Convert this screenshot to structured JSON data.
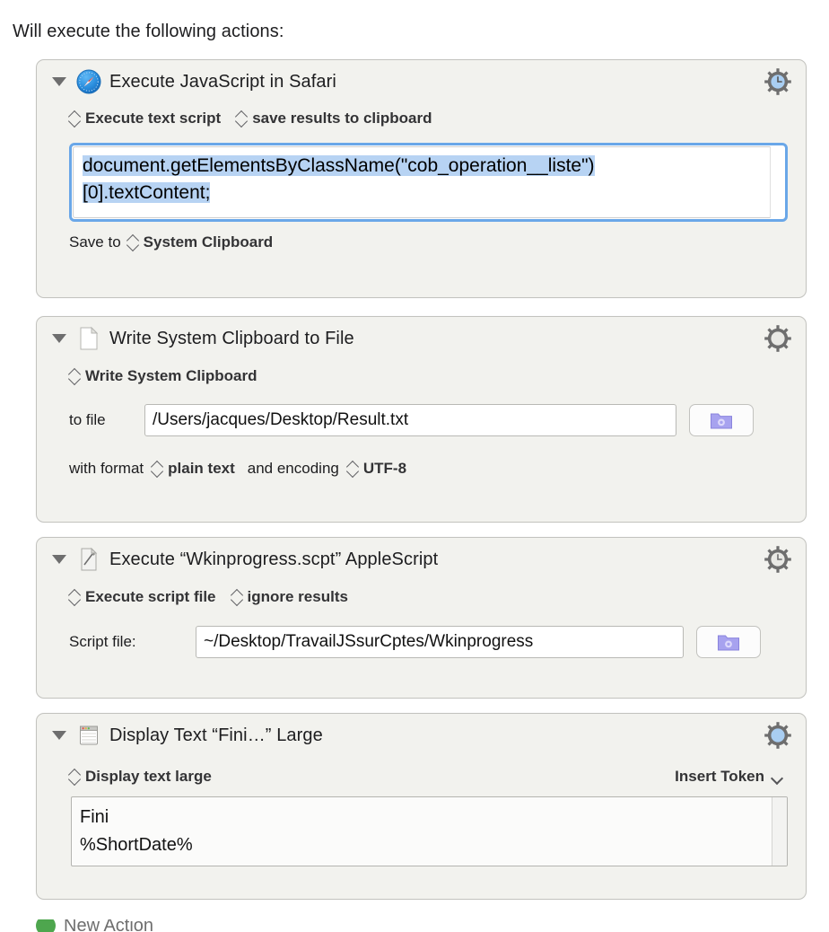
{
  "header": {
    "prompt": "Will execute the following actions:"
  },
  "actions": [
    {
      "icon": "safari-icon",
      "title": "Execute JavaScript in Safari",
      "gear": "gear-clock-blue-icon",
      "popup_mode": "Execute text script",
      "popup_results": "save results to clipboard",
      "script_selected_line1": "document.getElementsByClassName(\"cob_operation__liste\")",
      "script_selected_line2": "[0].textContent;",
      "save_to_label": "Save to",
      "save_to_value": "System Clipboard"
    },
    {
      "icon": "document-icon",
      "title": "Write System Clipboard to File",
      "gear": "gear-gray-icon",
      "popup_source": "Write System Clipboard",
      "to_file_label": "to file",
      "to_file_value": "/Users/jacques/Desktop/Result.txt",
      "folder_button": "folder-gear-icon",
      "format_label": "with format",
      "format_value": "plain text",
      "encoding_label": "and encoding",
      "encoding_value": "UTF-8"
    },
    {
      "icon": "applescript-icon",
      "title": "Execute “Wkinprogress.scpt” AppleScript",
      "gear": "gear-clock-gray-icon",
      "popup_mode": "Execute script file",
      "popup_results": "ignore results",
      "script_file_label": "Script file:",
      "script_file_value": "~/Desktop/TravailJSsurCptes/Wkinprogress",
      "folder_button": "folder-gear-icon"
    },
    {
      "icon": "window-icon",
      "title": "Display Text “Fini…” Large",
      "gear": "gear-blue-icon",
      "popup_mode": "Display text large",
      "insert_token": "Insert Token",
      "display_line1": "Fini",
      "display_line2": "%ShortDate%"
    }
  ],
  "bottom": {
    "new_action_label": "New Action"
  },
  "colors": {
    "block_bg": "#f2f2ee",
    "block_border": "#c3c3bf",
    "selection": "#b7d3f3",
    "focus_ring": "#6aa7e8",
    "folder_purple": "#9a96e8",
    "gear_blue": "#a9cef2",
    "green": "#4ea64e"
  }
}
